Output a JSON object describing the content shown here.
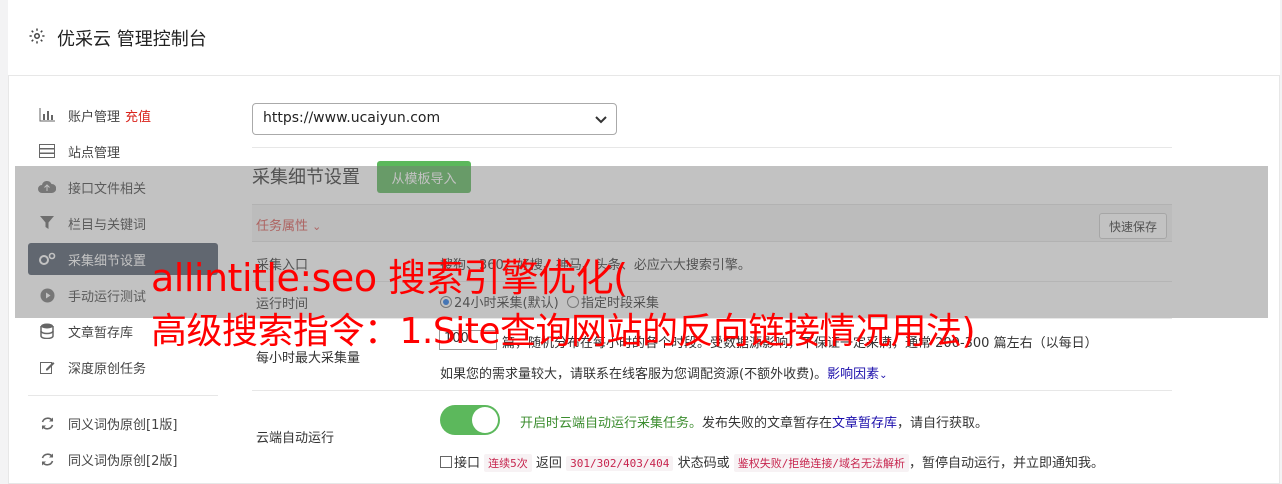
{
  "header": {
    "title": "优采云 管理控制台",
    "icon": "gear-icon"
  },
  "sidebar": {
    "items": [
      {
        "label": "账户管理",
        "extra": "充值",
        "icon": "bar-chart-icon"
      },
      {
        "label": "站点管理",
        "icon": "server-icon"
      },
      {
        "label": "接口文件相关",
        "icon": "cloud-upload-icon"
      },
      {
        "label": "栏目与关键词",
        "icon": "filter-icon"
      },
      {
        "label": "采集细节设置",
        "icon": "cogs-icon",
        "active": true
      },
      {
        "label": "手动运行测试",
        "icon": "play-circle-icon"
      },
      {
        "label": "文章暂存库",
        "icon": "database-icon"
      },
      {
        "label": "深度原创任务",
        "icon": "edit-icon"
      },
      {
        "label": "同义词伪原创[1版]",
        "icon": "refresh-icon"
      },
      {
        "label": "同义词伪原创[2版]",
        "icon": "refresh-icon"
      }
    ]
  },
  "site_select": {
    "value": "https://www.ucaiyun.com"
  },
  "section": {
    "title": "采集细节设置",
    "import_button": "从模板导入",
    "task_attr": "任务属性",
    "save_button": "快速保存"
  },
  "rows": {
    "source": {
      "label": "采集入口",
      "text": "搜狗、360、好搜、神马、头条、必应六大搜索引擎。"
    },
    "run_time": {
      "label": "运行时间",
      "opt1": "24小时采集(默认)",
      "opt2": "指定时段采集"
    },
    "max_per_hour": {
      "label": "每小时最大采集量",
      "value": "100",
      "text1": "篇，随机分布在每小时的各个时段。受数据源影响，不保证一定采满，通常 200-300 篇左右（以每日）",
      "text2": "如果您的需求量较大，请联系在线客服为您调配资源(不额外收费)。",
      "link": "影响因素"
    },
    "cloud_auto": {
      "label": "云端自动运行",
      "enabled_text": "开启时云端自动运行采集任务。",
      "text_a": "发布失败的文章暂存在",
      "link": "文章暂存库",
      "text_b": "，请自行获取。",
      "check_prefix": "接口",
      "code1": "连续5次",
      "mid1": "返回",
      "code2": "301/302/403/404",
      "mid2": "状态码或",
      "code3": "鉴权失败/拒绝连接/域名无法解析",
      "suffix": "，暂停自动运行，并立即通知我。"
    }
  },
  "overlay": {
    "line1": "allintitle:seo 搜索引擎优化(",
    "line2": "高级搜索指令：1.Site查询网站的反向链接情况用法)"
  }
}
